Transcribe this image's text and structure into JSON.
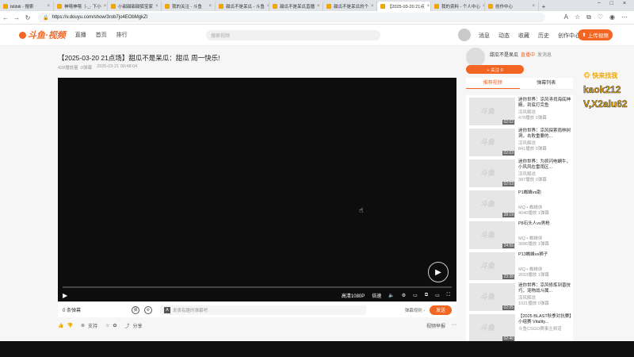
{
  "browser": {
    "tabs": [
      {
        "label": "bilibili - 搜索",
        "active": false
      },
      {
        "label": "神嘻神嘻（-_- 下小",
        "active": false
      },
      {
        "label": "小甜甜甜甜狐宝家",
        "active": false
      },
      {
        "label": "我的关注 - 斗鱼",
        "active": false
      },
      {
        "label": "甜瓜不是呆瓜 - 斗鱼",
        "active": false
      },
      {
        "label": "甜瓜不是呆瓜直播",
        "active": false
      },
      {
        "label": "甜瓜不是呆瓜的个",
        "active": false
      },
      {
        "label": "【2025-03-20 21点",
        "active": true
      },
      {
        "label": "我的资料 - 个人中心",
        "active": false
      },
      {
        "label": "创作中心",
        "active": false
      }
    ],
    "new_tab": "+",
    "url": "https://v.douyu.com/show/3rob7jo4EObMgkZl"
  },
  "header": {
    "logo_text": "斗鱼·视频",
    "nav": [
      "直播",
      "首页",
      "排行"
    ],
    "search_placeholder": "搜索视频",
    "right_nav": [
      "消息",
      "动态",
      "收藏",
      "历史",
      "创作中心"
    ],
    "upload_label": "上传视频"
  },
  "video": {
    "title": "【2025-03-20 21点场】甜瓜不是呆瓜：甜瓜 周一快乐!",
    "views": "428播放量 ·0弹幕",
    "date": "2025-03-21 00:48:04",
    "quality": "高清1080P",
    "speed": "倍速"
  },
  "danmu": {
    "count": "0 条弹幕",
    "placeholder": "发表有趣的弹幕吧",
    "settings": "弹幕规则 ›",
    "send_label": "发送"
  },
  "actions": {
    "support": "支持",
    "share": "分享",
    "report": "视频举报"
  },
  "uploader": {
    "name": "甜瓜不是呆瓜",
    "live_badge": "直播中",
    "subscribe": "发消息",
    "follow_label": "+ 关注 0"
  },
  "rtabs": [
    "推荐视频",
    "弹幕列表"
  ],
  "recommendations": [
    {
      "title": "迷你世界：凉风寻找海底神殿，到底打完鱼",
      "author": "凉风解说",
      "views": "478播放",
      "danmu": "0弹幕",
      "duration": "02:02"
    },
    {
      "title": "迷你世界：凉风探索雨林树洞，击败重要的...",
      "author": "凉风解说",
      "views": "841播放",
      "danmu": "0弹幕",
      "duration": "02:03"
    },
    {
      "title": "迷你世界：为抓闪电蜗牛，小风风在雷雨区...",
      "author": "凉风解说",
      "views": "387播放",
      "danmu": "0弹幕",
      "duration": "02:03"
    },
    {
      "title": "P1蜘蛛vs助",
      "author": "MQ • 蜘蛛侠",
      "views": "4046播放",
      "danmu": "1弹幕",
      "duration": "28:19"
    },
    {
      "title": "P8石头人vs男枪",
      "author": "MQ • 蜘蛛侠",
      "views": "3086播放",
      "danmu": "1弹幕",
      "duration": "24:56"
    },
    {
      "title": "P13蜘蛛vs狮子",
      "author": "MQ • 蜘蛛侠",
      "views": "2693播放",
      "danmu": "1弹幕",
      "duration": "23:38"
    },
    {
      "title": "迷你世界：凉风修炼到普技巧，宠物战斗属...",
      "author": "凉风解说",
      "views": "1021播放",
      "danmu": "0弹幕",
      "duration": "02:05"
    },
    {
      "title": "【2025 BLAST秋季对抗赛】小组赛 Vitality...",
      "author": "斗鱼CSGO赛事主频道",
      "views": "",
      "danmu": "",
      "duration": "02:40"
    }
  ],
  "overlay": {
    "tag": "快来找我",
    "line1": "kaok212",
    "line2": "V,X2alu62"
  },
  "colors": {
    "accent": "#f26522",
    "player_bg": "#0d0d0d"
  }
}
